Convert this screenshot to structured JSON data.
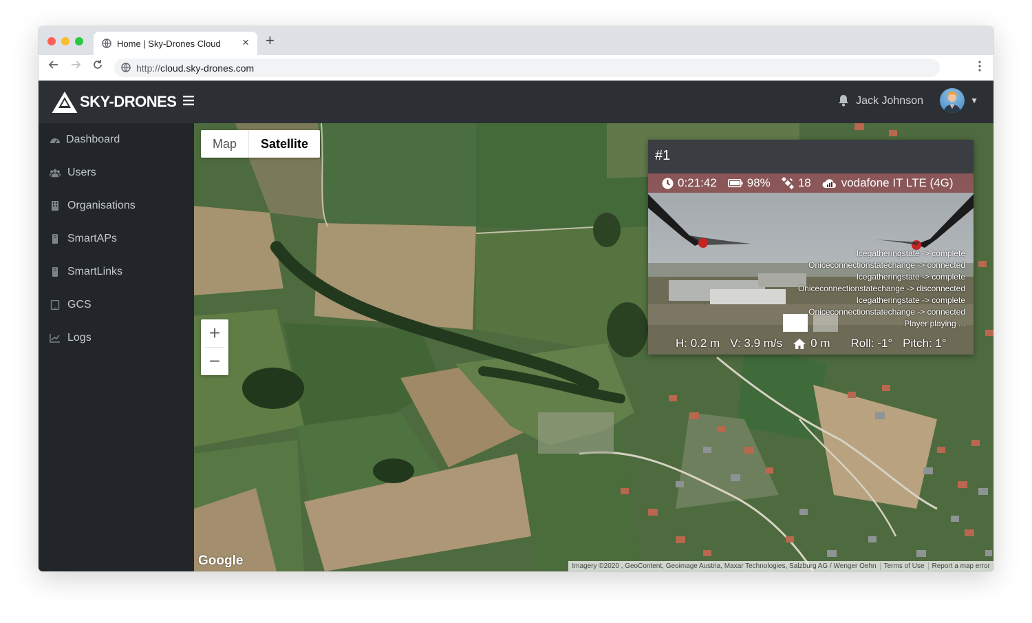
{
  "browser": {
    "tab_title": "Home | Sky-Drones Cloud",
    "tab_close": "×",
    "new_tab": "+",
    "url_scheme": "http://",
    "url_host": "cloud.sky-drones.com"
  },
  "header": {
    "logo_text": "SKY-DRONES",
    "user_name": "Jack Johnson"
  },
  "sidebar": {
    "items": [
      {
        "label": "Dashboard",
        "icon": "dashboard-icon"
      },
      {
        "label": "Users",
        "icon": "users-icon"
      },
      {
        "label": "Organisations",
        "icon": "building-icon"
      },
      {
        "label": "SmartAPs",
        "icon": "device-icon"
      },
      {
        "label": "SmartLinks",
        "icon": "device-icon"
      },
      {
        "label": "GCS",
        "icon": "tablet-icon"
      },
      {
        "label": "Logs",
        "icon": "chart-icon"
      }
    ]
  },
  "map": {
    "type_map": "Map",
    "type_satellite": "Satellite",
    "selected_type": "Satellite",
    "zoom_in": "+",
    "zoom_out": "−",
    "google_logo": "Google",
    "attribution": "Imagery ©2020 , GeoContent, Geoimage Austria, Maxar Technologies, Salzburg AG / Wenger Oehn",
    "terms": "Terms of Use",
    "report": "Report a map error"
  },
  "video_panel": {
    "title": "#1",
    "flight_time": "0:21:42",
    "battery": "98%",
    "satellites": "18",
    "network": "vodafone IT LTE (4G)",
    "log_lines": [
      "Icegatheringstate -> complete",
      "Oniceconnectionstatechange -> connected",
      "Icegatheringstate -> complete",
      "Oniceconnectionstatechange -> disconnected",
      "Icegatheringstate -> complete",
      "Oniceconnectionstatechange -> connected",
      "Player playing ..."
    ],
    "height": "H: 0.2 m",
    "velocity": "V: 3.9 m/s",
    "home_distance": "0 m",
    "roll": "Roll: -1°",
    "pitch": "Pitch: 1°"
  },
  "colors": {
    "topbar": "#2c3035",
    "sidebar": "#22262a",
    "status_overlay": "#7a1414"
  }
}
